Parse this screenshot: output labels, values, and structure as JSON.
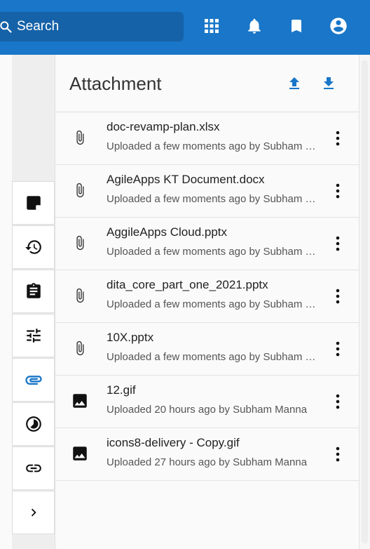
{
  "search": {
    "placeholder": "Search"
  },
  "topbar": {
    "icons": [
      "apps-grid-icon",
      "notifications-bell-icon",
      "bookmark-icon",
      "account-circle-icon"
    ],
    "color": "#1976c8"
  },
  "rail": {
    "items": [
      {
        "icon": "note-icon",
        "active": false
      },
      {
        "icon": "history-icon",
        "active": false
      },
      {
        "icon": "clipboard-icon",
        "active": false
      },
      {
        "icon": "tune-sliders-icon",
        "active": false
      },
      {
        "icon": "attachment-clip-icon",
        "active": true
      },
      {
        "icon": "timelapse-icon",
        "active": false
      },
      {
        "icon": "link-icon",
        "active": false
      },
      {
        "icon": "chevron-right-icon",
        "active": false
      }
    ],
    "active_color": "#1976c8"
  },
  "panel": {
    "title": "Attachment",
    "actions": [
      "upload-icon",
      "download-icon"
    ]
  },
  "attachments": [
    {
      "name": "doc-revamp-plan.xlsx",
      "meta": "Uploaded a few moments ago by Subham Manna",
      "type": "file"
    },
    {
      "name": "AgileApps KT Document.docx",
      "meta": "Uploaded a few moments ago by Subham Manna",
      "type": "file"
    },
    {
      "name": "AggileApps Cloud.pptx",
      "meta": "Uploaded a few moments ago by Subham Manna",
      "type": "file"
    },
    {
      "name": "dita_core_part_one_2021.pptx",
      "meta": "Uploaded a few moments ago by Subham Manna",
      "type": "file"
    },
    {
      "name": "10X.pptx",
      "meta": "Uploaded a few moments ago by Subham Manna",
      "type": "file"
    },
    {
      "name": "12.gif",
      "meta": "Uploaded 20 hours ago by Subham Manna",
      "type": "image"
    },
    {
      "name": "icons8-delivery - Copy.gif",
      "meta": "Uploaded 27 hours ago by Subham Manna",
      "type": "image"
    }
  ]
}
